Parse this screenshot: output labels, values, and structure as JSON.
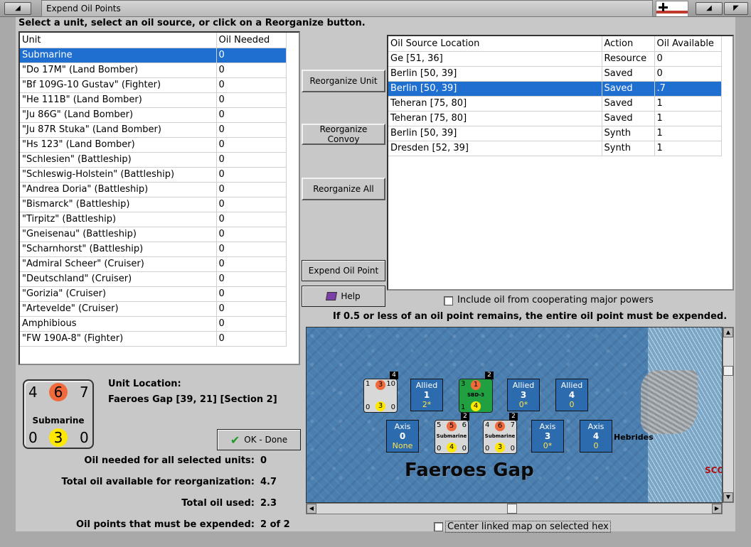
{
  "window": {
    "title": "Expend Oil Points"
  },
  "instruction": "Select a unit, select an oil source, or click on a Reorganize button.",
  "units_table": {
    "headers": [
      "Unit",
      "Oil Needed"
    ],
    "rows": [
      [
        "Submarine",
        "0"
      ],
      [
        "\"Do 17M\" (Land Bomber)",
        "0"
      ],
      [
        "\"Bf 109G-10 Gustav\" (Fighter)",
        "0"
      ],
      [
        "\"He 111B\" (Land Bomber)",
        "0"
      ],
      [
        "\"Ju 86G\" (Land Bomber)",
        "0"
      ],
      [
        "\"Ju 87R Stuka\" (Land Bomber)",
        "0"
      ],
      [
        "\"Hs 123\" (Land Bomber)",
        "0"
      ],
      [
        "\"Schlesien\" (Battleship)",
        "0"
      ],
      [
        "\"Schleswig-Holstein\" (Battleship)",
        "0"
      ],
      [
        "\"Andrea Doria\" (Battleship)",
        "0"
      ],
      [
        "\"Bismarck\" (Battleship)",
        "0"
      ],
      [
        "\"Tirpitz\" (Battleship)",
        "0"
      ],
      [
        "\"Gneisenau\" (Battleship)",
        "0"
      ],
      [
        "\"Scharnhorst\" (Battleship)",
        "0"
      ],
      [
        "\"Admiral Scheer\" (Cruiser)",
        "0"
      ],
      [
        "\"Deutschland\" (Cruiser)",
        "0"
      ],
      [
        "\"Gorizia\" (Cruiser)",
        "0"
      ],
      [
        "\"Artevelde\" (Cruiser)",
        "0"
      ],
      [
        "Amphibious",
        "0"
      ],
      [
        "\"FW 190A-8\" (Fighter)",
        "0"
      ]
    ],
    "selected_row": 0
  },
  "sources_table": {
    "headers": [
      "Oil Source Location",
      "Action",
      "Oil Available"
    ],
    "rows": [
      [
        "Ge [51, 36]",
        "Resource",
        "0"
      ],
      [
        "Berlin [50, 39]",
        "Saved",
        "0"
      ],
      [
        "Berlin [50, 39]",
        "Saved",
        ".7"
      ],
      [
        "Teheran [75, 80]",
        "Saved",
        "1"
      ],
      [
        "Teheran [75, 80]",
        "Saved",
        "1"
      ],
      [
        "Berlin [50, 39]",
        "Synth",
        "1"
      ],
      [
        "Dresden [52, 39]",
        "Synth",
        "1"
      ]
    ],
    "selected_row": 2
  },
  "buttons": {
    "reorganize_unit": "Reorganize Unit",
    "reorganize_convoy": "Reorganize Convoy",
    "reorganize_all": "Reorganize All",
    "expend_oil_point": "Expend Oil Point",
    "help": "Help",
    "ok_done": "OK - Done"
  },
  "include_oil_label": "Include oil from cooperating major powers",
  "rule_note": "If 0.5 or less of an oil point remains, the entire oil point must be expended.",
  "counter": {
    "top_left": "4",
    "top_mid": "6",
    "top_right": "7",
    "name": "Submarine",
    "bottom_left": "0",
    "bottom_mid": "3",
    "bottom_right": "0",
    "colors": {
      "top_circle": "#f06a3c",
      "bottom_circle": "#ffe800"
    }
  },
  "unit_location": {
    "label": "Unit Location:",
    "value": "Faeroes Gap [39, 21] [Section 2]"
  },
  "summary": {
    "oil_needed_label": "Oil needed for all selected units:",
    "oil_needed_value": "0",
    "total_available_label": "Total oil available for reorganization:",
    "total_available_value": "4.7",
    "total_used_label": "Total oil used:",
    "total_used_value": "2.3",
    "must_expend_label": "Oil points that must be expended:",
    "must_expend_value": "2 of 2"
  },
  "map": {
    "hex_name": "Faeroes Gap",
    "place_name": "Hebrides",
    "place_red": "SCO",
    "allied_boxes": [
      {
        "title": "Allied",
        "value": "1",
        "sub": "2*"
      },
      {
        "title": "Allied",
        "value": "3",
        "sub": "0*"
      },
      {
        "title": "Allied",
        "value": "4",
        "sub": "0"
      }
    ],
    "axis_boxes": [
      {
        "title": "Axis",
        "value": "0",
        "sub": "None"
      },
      {
        "title": "Axis",
        "value": "3",
        "sub": "0*"
      },
      {
        "title": "Axis",
        "value": "4",
        "sub": "0"
      }
    ],
    "counters": [
      {
        "tl": "1",
        "tm": "3",
        "tr": "10",
        "bl": "0",
        "bm": "3",
        "br": "0",
        "tag": "4",
        "name": ""
      },
      {
        "tl": "3",
        "tm": "1",
        "tr": "",
        "bl": "1",
        "bm": "4",
        "br": "",
        "tag": "2",
        "name": "SBD-3"
      },
      {
        "tl": "5",
        "tm": "5",
        "tr": "6",
        "bl": "0",
        "bm": "4",
        "br": "0",
        "tag": "2",
        "name": "Submarine"
      },
      {
        "tl": "4",
        "tm": "6",
        "tr": "7",
        "bl": "0",
        "bm": "3",
        "br": "0",
        "tag": "2",
        "name": "Submarine"
      }
    ]
  },
  "center_map_label": "Center linked map on selected hex"
}
